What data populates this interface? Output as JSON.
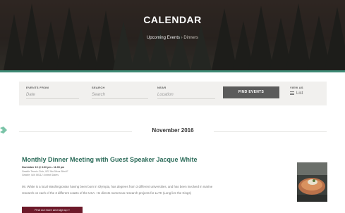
{
  "hero": {
    "title": "CALENDAR",
    "breadcrumb": {
      "link": "Upcoming Events",
      "separator": "›",
      "current": "Dinners"
    }
  },
  "filters": {
    "events_from": {
      "label": "EVENTS FROM",
      "placeholder": "Date"
    },
    "search": {
      "label": "SEARCH",
      "placeholder": "Search"
    },
    "near": {
      "label": "NEAR",
      "placeholder": "Location"
    },
    "find_button": "FIND EVENTS",
    "view_as": {
      "label": "VIEW AS",
      "value": "List"
    }
  },
  "month": "November 2016",
  "event": {
    "title": "Monthly Dinner Meeting with Guest Speaker Jacque White",
    "date": "November 15 @ 6:30 pm - 11:00 pm",
    "venue": "Seattle Tennis Club, 922 McGilvra Blvd E",
    "address": "Seattle, WA 98112 United States",
    "description": "Mr. White is a local Washingtonian having been born in Olympia, has degrees from 3 different universities, and has been involved in marine research on each of the 3 different coasts of the USA. He directs numerous research projects for LLTK (Long live the Kings)",
    "button": "Find out more and sign up »"
  },
  "colors": {
    "accent": "#3e8a75",
    "title": "#2b6b59",
    "button": "#6d1a2a",
    "find_button": "#5b5b5b"
  }
}
